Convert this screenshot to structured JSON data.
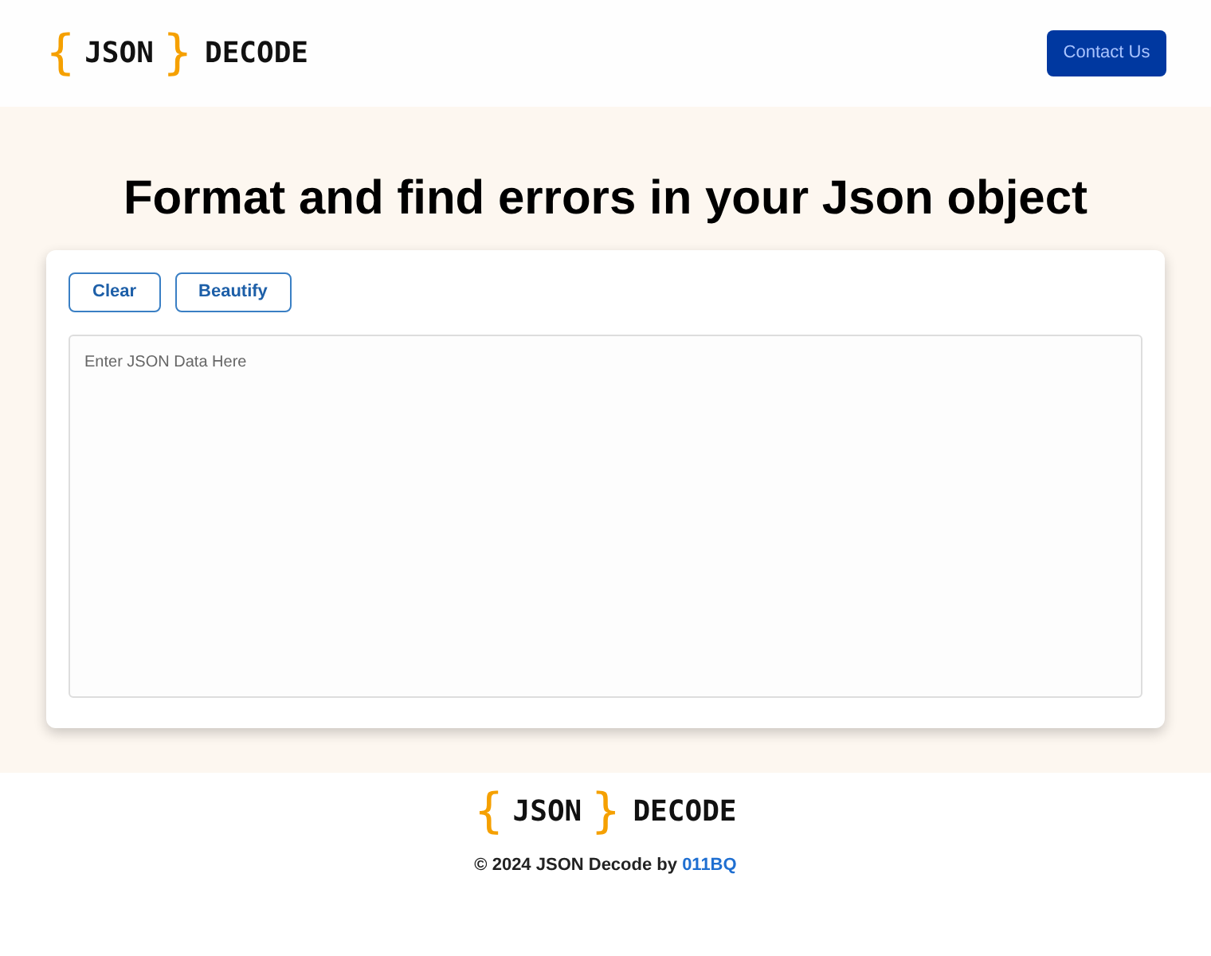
{
  "header": {
    "logo": {
      "open_brace": "{",
      "word": "JSON",
      "close_brace": "}",
      "suffix": "DECODE"
    },
    "contact_button": "Contact Us"
  },
  "hero": {
    "title": "Format and find errors in your Json object"
  },
  "editor": {
    "buttons": [
      "Clear",
      "Beautify"
    ],
    "input": {
      "placeholder": "Enter JSON Data Here"
    }
  },
  "footer": {
    "logo": {
      "open_brace": "{",
      "word": "JSON",
      "close_brace": "}",
      "suffix": "DECODE"
    },
    "copyright": "© 2024 JSON Decode by",
    "author_link": "011BQ"
  }
}
